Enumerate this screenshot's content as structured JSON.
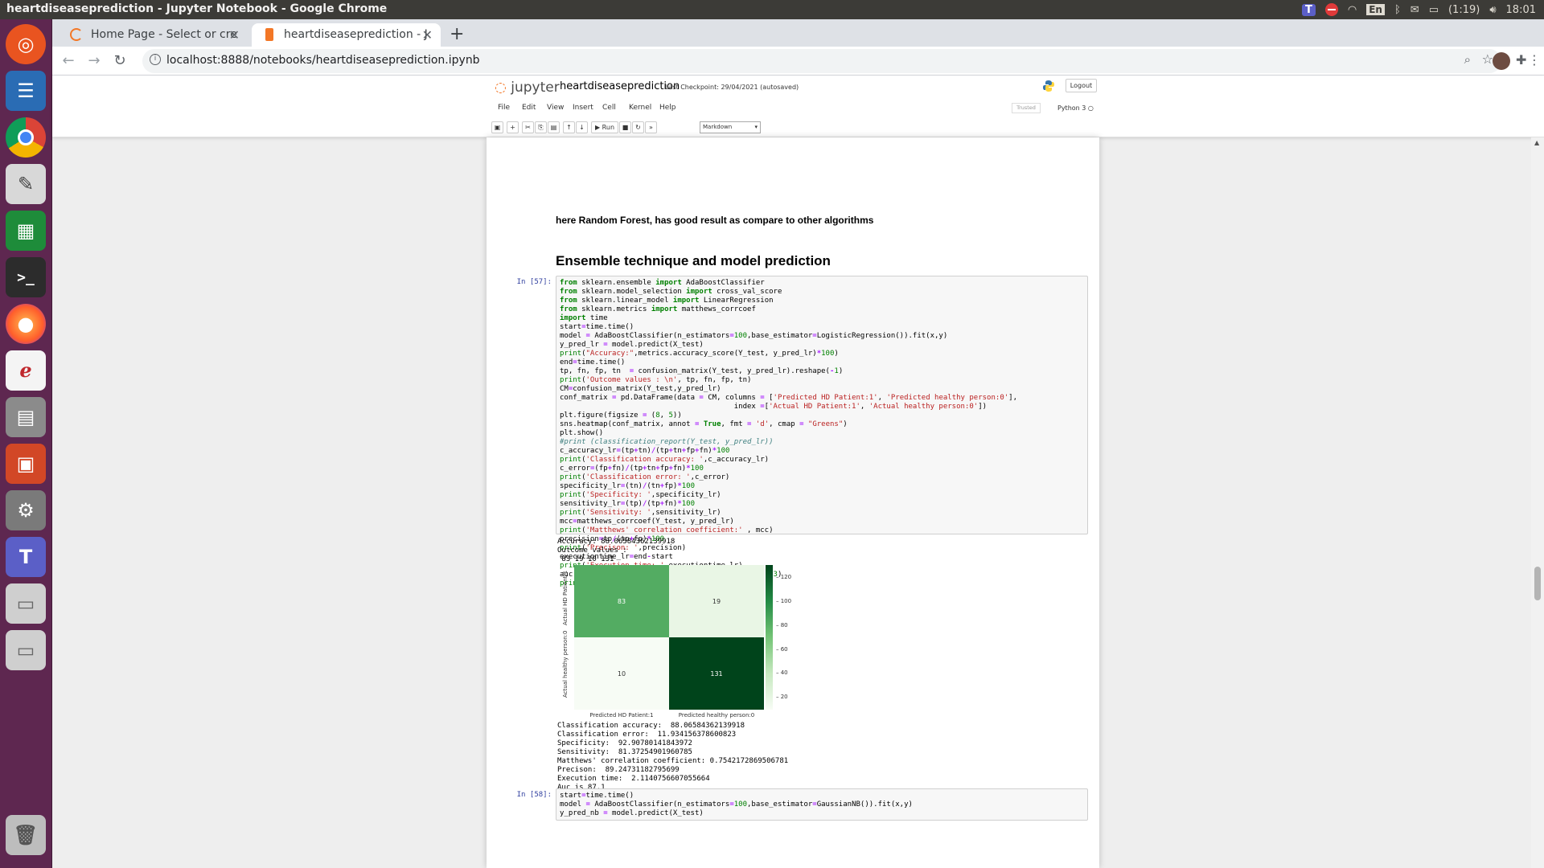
{
  "os": {
    "window_title": "heartdiseaseprediction - Jupyter Notebook - Google Chrome",
    "tray": {
      "teams": "T",
      "lang": "En",
      "battery": "(1:19)",
      "clock": "18:01"
    }
  },
  "dock": [
    "ubuntu-icon",
    "writer-icon",
    "chrome-icon",
    "text-editor-icon",
    "calc-icon",
    "terminal-icon",
    "firefox-icon",
    "evince-icon",
    "files-icon",
    "impress-icon",
    "settings-icon",
    "teams-icon",
    "drive-icon",
    "drive2-icon",
    "trash-icon"
  ],
  "browser": {
    "tabs": [
      {
        "label": "Home Page - Select or cre",
        "active": false
      },
      {
        "label": "heartdiseaseprediction - J",
        "active": true
      }
    ],
    "url": "localhost:8888/notebooks/heartdiseaseprediction.ipynb"
  },
  "jupyter": {
    "logo": "jupyter",
    "notebook_name": "heartdiseaseprediction",
    "checkpoint": "Last Checkpoint: 29/04/2021  (autosaved)",
    "logout": "Logout",
    "menu": [
      "File",
      "Edit",
      "View",
      "Insert",
      "Cell",
      "Kernel",
      "Help"
    ],
    "trusted": "Trusted",
    "kernel": "Python 3",
    "run_label": "Run",
    "cell_type": "Markdown"
  },
  "cells": {
    "md1": "here Random Forest, has good result as compare to other algorithms",
    "heading": "Ensemble technique and model prediction",
    "prompt57": "In [57]:",
    "out57_top": "Accuracy: 88.06584362139918\nOutcome values : \n 83 19 10 131",
    "out57_bottom": "Classification accuracy:  88.06584362139918\nClassification error:  11.934156378600823\nSpecificity:  92.90780141843972\nSensitivity:  81.37254901960785\nMatthews' correlation coefficient: 0.7542172869506781\nPrecison:  89.24731182795699\nExecution time:  2.1140756607055664\nAuc is 87.1",
    "prompt58": "In [58]:"
  },
  "chart_data": {
    "type": "heatmap",
    "rows": [
      "Actual HD Patient:1",
      "Actual healthy person:0"
    ],
    "columns": [
      "Predicted HD Patient:1",
      "Predicted healthy person:0"
    ],
    "values": [
      [
        83,
        19
      ],
      [
        10,
        131
      ]
    ],
    "colormap": "Greens",
    "colorbar_ticks": [
      "20",
      "40",
      "60",
      "80",
      "100",
      "120"
    ],
    "colorbar_range": [
      10,
      131
    ]
  }
}
